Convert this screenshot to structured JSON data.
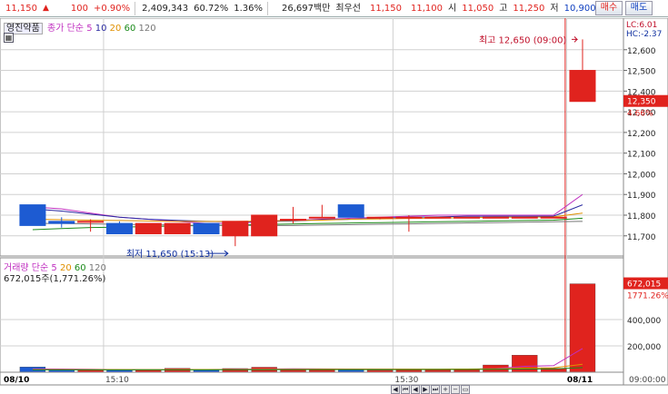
{
  "quote": {
    "price": "11,150",
    "change": "100",
    "change_pct": "+0.90%",
    "volume": "2,409,343",
    "ratio": "60.72%",
    "turnover": "1.36%",
    "amount": "26,697백만",
    "best_bid_label": "최우선",
    "best_ask": "11,150",
    "best_bid": "11,100",
    "open_label": "시",
    "open": "11,050",
    "high_label": "고",
    "high": "11,250",
    "low_label": "저",
    "low": "10,900",
    "buy_label": "매수",
    "sell_label": "매도"
  },
  "price_panel": {
    "stock_name": "영진약품",
    "indicator": "종가",
    "ma_type": "단순",
    "ma_periods": [
      "5",
      "10",
      "20",
      "60",
      "120"
    ],
    "ma_colors": [
      "#c030c0",
      "#2a2aa0",
      "#e09000",
      "#1a8a1a",
      "#777777"
    ],
    "lc_label": "LC:6.01",
    "hc_label": "HC:-2.37",
    "max_note": "최고 12,650 (09:00)",
    "min_note": "최저 11,650 (15:13)",
    "current_price": "12,350",
    "current_pct": "4.66%"
  },
  "volume_panel": {
    "title": "거래량",
    "ma_type": "단순",
    "ma_periods": [
      "5",
      "20",
      "60",
      "120"
    ],
    "ma_colors": [
      "#c030c0",
      "#e09000",
      "#1a8a1a",
      "#777777"
    ],
    "summary": "672,015주(1,771.26%)",
    "current_volume": "672,015",
    "current_pct": "1771.26%"
  },
  "colors": {
    "up": "#e0231e",
    "down": "#1d5bd2",
    "grid": "#d0d0d0"
  },
  "chart_data": {
    "type": "candlestick",
    "price_ticks": [
      11700,
      11800,
      11900,
      12000,
      12100,
      12200,
      12300,
      12400,
      12500,
      12600
    ],
    "price_range": [
      11620,
      12700
    ],
    "volume_ticks": [
      200000,
      400000
    ],
    "volume_range": [
      0,
      800000
    ],
    "time_labels": [
      "08/10",
      "15:10",
      "15:30",
      "08/11",
      "09:00:00"
    ],
    "candles": [
      {
        "o": 11850,
        "h": 11850,
        "l": 11750,
        "c": 11750,
        "v": 40000
      },
      {
        "o": 11770,
        "h": 11790,
        "l": 11740,
        "c": 11760,
        "v": 15000
      },
      {
        "o": 11770,
        "h": 11780,
        "l": 11720,
        "c": 11770,
        "v": 18000
      },
      {
        "o": 11760,
        "h": 11770,
        "l": 11710,
        "c": 11710,
        "v": 16000
      },
      {
        "o": 11710,
        "h": 11760,
        "l": 11710,
        "c": 11760,
        "v": 20000
      },
      {
        "o": 11710,
        "h": 11760,
        "l": 11710,
        "c": 11760,
        "v": 30000
      },
      {
        "o": 11760,
        "h": 11760,
        "l": 11710,
        "c": 11710,
        "v": 17000
      },
      {
        "o": 11700,
        "h": 11770,
        "l": 11650,
        "c": 11770,
        "v": 28000
      },
      {
        "o": 11700,
        "h": 11800,
        "l": 11700,
        "c": 11800,
        "v": 38000
      },
      {
        "o": 11780,
        "h": 11840,
        "l": 11760,
        "c": 11780,
        "v": 22000
      },
      {
        "o": 11790,
        "h": 11850,
        "l": 11790,
        "c": 11790,
        "v": 18000
      },
      {
        "o": 11850,
        "h": 11850,
        "l": 11790,
        "c": 11790,
        "v": 20000
      },
      {
        "o": 11790,
        "h": 11790,
        "l": 11780,
        "c": 11790,
        "v": 15000
      },
      {
        "o": 11790,
        "h": 11800,
        "l": 11720,
        "c": 11790,
        "v": 22000
      },
      {
        "o": 11790,
        "h": 11790,
        "l": 11790,
        "c": 11790,
        "v": 20000
      },
      {
        "o": 11790,
        "h": 11790,
        "l": 11790,
        "c": 11790,
        "v": 24000
      },
      {
        "o": 11790,
        "h": 11790,
        "l": 11790,
        "c": 11790,
        "v": 55000
      },
      {
        "o": 11790,
        "h": 11790,
        "l": 11790,
        "c": 11790,
        "v": 130000
      },
      {
        "o": 11790,
        "h": 11790,
        "l": 11790,
        "c": 11790,
        "v": 30000
      },
      {
        "o": 12350,
        "h": 12650,
        "l": 12350,
        "c": 12500,
        "v": 672015
      }
    ]
  }
}
